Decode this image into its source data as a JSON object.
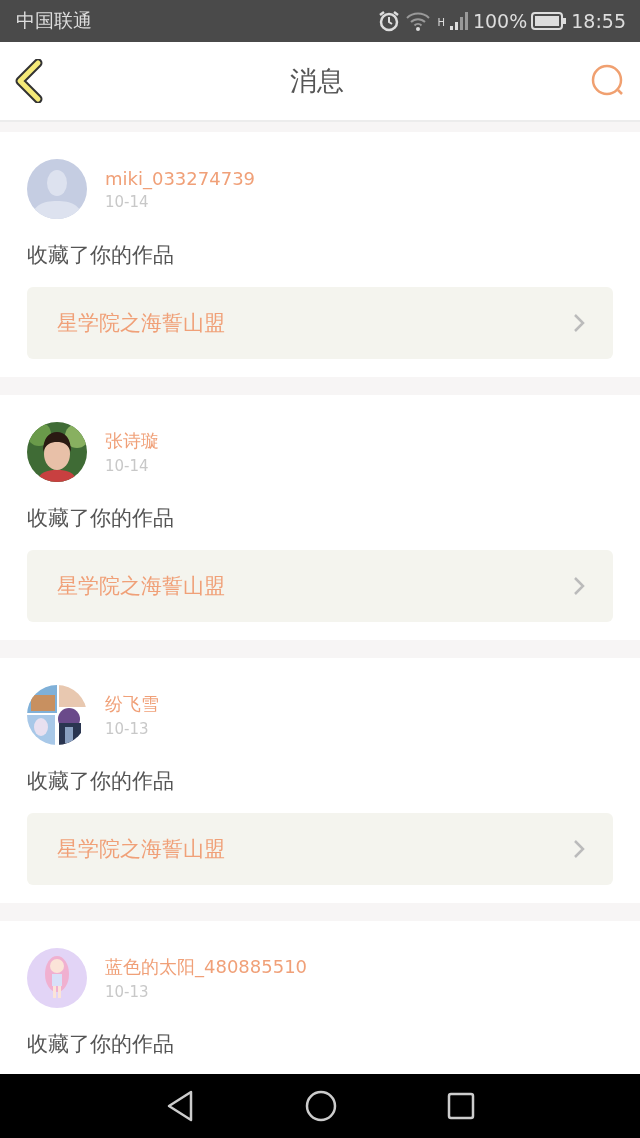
{
  "status_bar": {
    "carrier": "中国联通",
    "network_type": "H",
    "battery": "100%",
    "time": "18:55"
  },
  "header": {
    "title": "消息"
  },
  "messages": [
    {
      "user": "miki_033274739",
      "date": "10-14",
      "avatar": {
        "kind": "default"
      },
      "action": "收藏了你的作品",
      "work": "星学院之海誓山盟"
    },
    {
      "user": "张诗璇",
      "date": "10-14",
      "action": "收藏了你的作品",
      "work": "星学院之海誓山盟"
    },
    {
      "user": "纷飞雪",
      "date": "10-13",
      "avatar": {
        "kind": "collage"
      },
      "action": "收藏了你的作品",
      "work": "星学院之海誓山盟"
    },
    {
      "user": "蓝色的太阳_480885510",
      "date": "10-13",
      "avatar": {
        "kind": "cartoon"
      },
      "action": "收藏了你的作品"
    }
  ]
}
